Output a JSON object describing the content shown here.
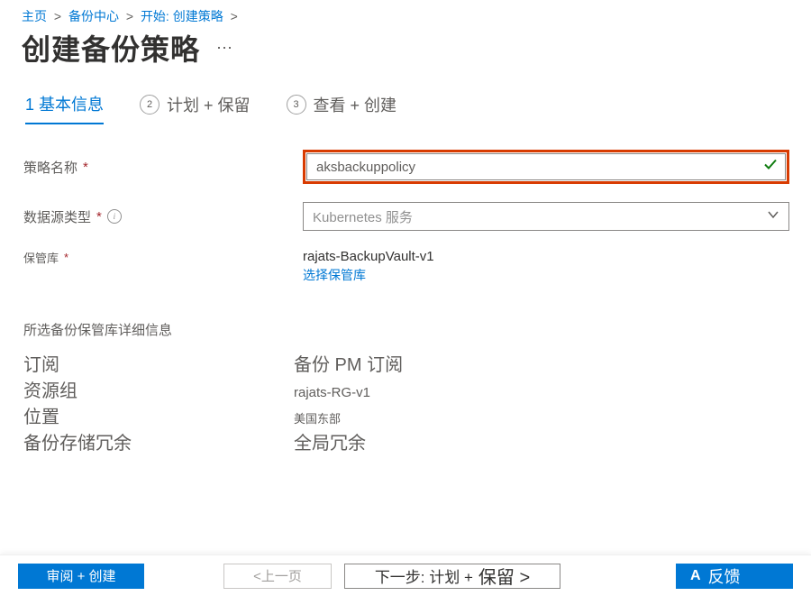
{
  "breadcrumb": {
    "items": [
      "主页",
      "备份中心",
      "开始: 创建策略"
    ]
  },
  "header": {
    "title": "创建备份策略"
  },
  "tabs": [
    {
      "label": "1 基本信息"
    },
    {
      "num": "2",
      "label": "计划 + 保留"
    },
    {
      "num": "3",
      "label": "查看 + 创建"
    }
  ],
  "form": {
    "policyName": {
      "label": "策略名称",
      "value": "aksbackuppolicy"
    },
    "datasourceType": {
      "label": "数据源类型",
      "value": "Kubernetes 服务"
    },
    "vault": {
      "label": "保管库",
      "value": "rajats-BackupVault-v1",
      "linkText": "选择保管库"
    }
  },
  "details": {
    "title": "所选备份保管库详细信息",
    "rows": {
      "subscription": {
        "label": "订阅",
        "value": "备份 PM 订阅"
      },
      "resourceGroup": {
        "label": "资源组",
        "value": "rajats-RG-v1"
      },
      "location": {
        "label": "位置",
        "value": "美国东部"
      },
      "redundancy": {
        "label": "备份存储冗余",
        "value": "全局冗余"
      }
    }
  },
  "footer": {
    "review": "审阅 + 创建",
    "prev": "<上一页",
    "next_part1": "下一步: 计划 +",
    "next_part2": "保留 >",
    "feedback": "反馈",
    "feedback_icon": "A"
  }
}
